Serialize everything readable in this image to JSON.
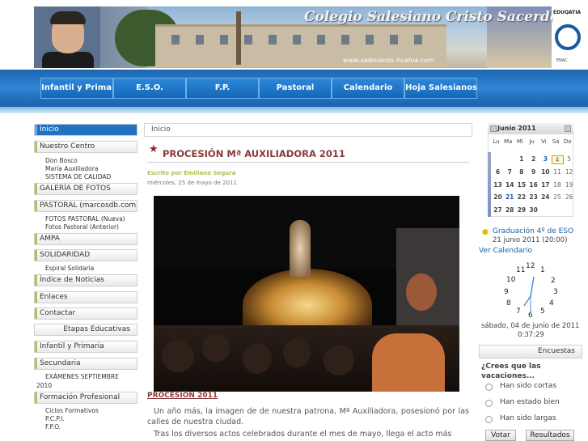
{
  "header": {
    "school_title": "Colegio Salesiano Cristo Sacerdote",
    "website": "www.salesianos-huelva.com",
    "accreditation": {
      "name": "EDUQATIA",
      "body": "ENAC"
    }
  },
  "nav": {
    "items": [
      {
        "label": "Infantil y Primaria"
      },
      {
        "label": "E.S.O."
      },
      {
        "label": "F.P."
      },
      {
        "label": "Pastoral"
      },
      {
        "label": "Calendario"
      },
      {
        "label": "Hoja Salesianos"
      }
    ]
  },
  "sidebar": {
    "menu": [
      {
        "label": "Inicio"
      },
      {
        "label": "Nuestro Centro"
      },
      {
        "label": "GALERÍA DE FOTOS"
      },
      {
        "label": "PASTORAL (marcosdb.com)"
      },
      {
        "label": "AMPA"
      },
      {
        "label": "SOLIDARIDAD"
      },
      {
        "label": "Índice de Noticias"
      },
      {
        "label": "Enlaces"
      },
      {
        "label": "Contactar"
      },
      {
        "label": "Etapas Educativas"
      },
      {
        "label": "Infantil y Primaria"
      },
      {
        "label": "Secundaria"
      },
      {
        "label": "Formación Profesional"
      }
    ],
    "sub": {
      "centro": [
        "Don Bosco",
        "María Auxiliadora",
        "SISTEMA DE CALIDAD"
      ],
      "pastoral": [
        "FOTOS PASTORAL (Nueva)",
        "Fotos Pastoral (Anterior)"
      ],
      "solidaridad": [
        "Espiral Solidaria"
      ],
      "secundaria": [
        "EXÁMENES SEPTIEMBRE",
        "2010"
      ],
      "fp": [
        "Ciclos Formativos",
        "P.C.P.I.",
        "F.P.O."
      ]
    }
  },
  "breadcrumb": "Inicio",
  "article": {
    "title": "PROCESIÓN Mª AUXILIADORA 2011",
    "author": "Escrito por Emiliano Segura",
    "date": "miércoles, 25 de mayo de 2011",
    "image_caption": "PROCESIÓN 2011",
    "paragraph1": "Un año más, la imagen de de nuestra patrona, Mª Auxiliadora, posesionó por las calles de nuestra ciudad.",
    "paragraph2": "Tras los diversos actos celebrados durante el mes de mayo, llega el acto más"
  },
  "calendar": {
    "month": "Junio 2011",
    "weekdays": [
      "Lu",
      "Ma",
      "Mi",
      "Ju",
      "Vi",
      "Sá",
      "Do"
    ],
    "rows": [
      [
        "",
        "",
        "1",
        "2",
        "3",
        "4",
        "5"
      ],
      [
        "6",
        "7",
        "8",
        "9",
        "10",
        "11",
        "12"
      ],
      [
        "13",
        "14",
        "15",
        "16",
        "17",
        "18",
        "19"
      ],
      [
        "20",
        "21",
        "22",
        "23",
        "24",
        "25",
        "26"
      ],
      [
        "27",
        "28",
        "29",
        "30",
        "",
        "",
        ""
      ]
    ],
    "event_title": "Graduación 4º de ESO",
    "event_date": "21 junio 2011 (20:00)",
    "see_calendar": "Ver Calendario"
  },
  "clock": {
    "numbers": [
      "12",
      "1",
      "2",
      "3",
      "4",
      "5",
      "6",
      "7",
      "8",
      "9",
      "10",
      "11"
    ],
    "date": "sábado, 04 de junio de 2011",
    "time": "0:37:29"
  },
  "poll": {
    "header": "Encuestas",
    "question": "¿Crees que las vacaciones...",
    "options": [
      "Han sido cortas",
      "Han estado bien",
      "Han sido largas"
    ],
    "vote_label": "Votar",
    "results_label": "Resultados"
  },
  "colors": {
    "nav_blue": "#1f73c2",
    "title_red": "#8a3a3a",
    "author_green": "#a8c056",
    "link_blue": "#1a5fa8"
  }
}
